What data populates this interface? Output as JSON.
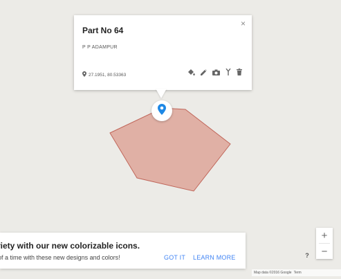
{
  "map": {
    "background_color": "#ecebe7",
    "polygon_fill": "#dc9c8f",
    "polygon_stroke": "#c0665a"
  },
  "info_window": {
    "title": "Part No 64",
    "subtitle": "P P ADAMPUR",
    "coordinates": "27.1951, 80.53363",
    "close_label": "×",
    "actions": [
      "paint-bucket-icon",
      "pencil-icon",
      "camera-icon",
      "route-icon",
      "trash-icon"
    ]
  },
  "marker": {
    "icon": "map-pin-icon",
    "color": "#1e88e5"
  },
  "promo": {
    "title": "riety with our new colorizable icons.",
    "subtitle": " of a time with these new designs and colors!",
    "got_it": "GOT IT",
    "learn_more": "LEARN MORE",
    "accent_color": "#4285f4"
  },
  "controls": {
    "zoom_in": "+",
    "zoom_out": "−",
    "help": "?"
  },
  "footer": {
    "attribution": "Map data ©2016 Google",
    "terms": "Term"
  }
}
